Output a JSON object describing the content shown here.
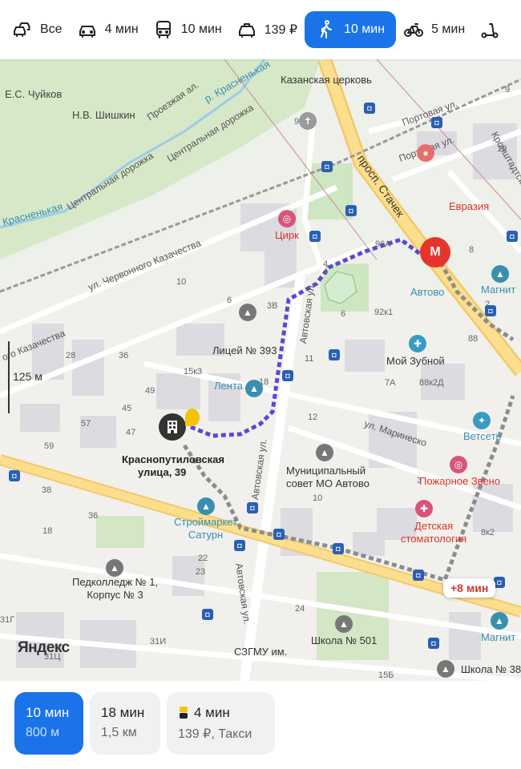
{
  "modes": [
    {
      "label": "Все",
      "icon": "cars-all-icon"
    },
    {
      "label": "4 мин",
      "icon": "car-icon"
    },
    {
      "label": "10 мин",
      "icon": "bus-icon"
    },
    {
      "label": "139 ₽",
      "icon": "taxi-icon"
    },
    {
      "label": "10 мин",
      "icon": "walk-icon",
      "active": true
    },
    {
      "label": "5 мин",
      "icon": "bicycle-icon"
    },
    {
      "label": "",
      "icon": "scooter-icon"
    }
  ],
  "map": {
    "labels": {
      "chuikov": "Е.С. Чуйков",
      "shishkin": "Н.В. Шишкин",
      "proezzhaya": "Проезжая ал.",
      "krasnenkaya_top": "р. Красненькая",
      "krasnenkaya_left": "Красненькая",
      "central1": "Центральная дорожка",
      "central2": "Центральная дорожка",
      "kazan_church": "Казанская церковь",
      "portovaya1": "Портовая ул.",
      "portovaya2": "Портовая ул.",
      "kronshtadt": "Кронштадтская ул.",
      "stachek": "просп. Стачек",
      "evraziya": "Евразия",
      "circus": "Цирк",
      "chervonnogo": "ул. Червонного Казачества",
      "kazachestva": "ого Казачества",
      "avtovskaya_top": "Автовская ул.",
      "avtovskaya_mid": "Автовская ул.",
      "avtovskaya_bot": "Автовская ул.",
      "metro_station": "Автово",
      "metro_pin": "М",
      "magnit_top": "Магнит",
      "lyceum": "Лицей № 393",
      "lenta": "Лента",
      "moy_zubnoy": "Мой Зубной",
      "marinesko": "ул. Маринеско",
      "vetset": "Ветсеть",
      "dest_line1": "Краснопутиловская",
      "dest_line2": "улица, 39",
      "municipal1": "Муниципальный",
      "municipal2": "совет МО Автово",
      "pozharnoe": "Пожарное Звено",
      "stroymarket1": "Строймаркет",
      "stroymarket2": "Сатурн",
      "dental1": "Детская",
      "dental2": "стоматология",
      "pedcollege1": "Педколледж № 1,",
      "pedcollege2": "Корпус № 3",
      "school501": "Школа № 501",
      "school386": "Школа № 386",
      "szgmu": "СЗГМУ им.",
      "magnit_bot": "Магнит"
    },
    "numbers": [
      "98В",
      "19",
      "9",
      "6",
      "4",
      "96А",
      "10",
      "6",
      "3В",
      "92к1",
      "6",
      "15к3",
      "88к2Д",
      "7А",
      "12",
      "28",
      "36",
      "49",
      "45",
      "47",
      "59",
      "57",
      "38",
      "36",
      "18",
      "22",
      "23",
      "8к2",
      "24",
      "31Г",
      "31И",
      "31Ц",
      "15Б",
      "10",
      "11",
      "18",
      "8",
      "4",
      "2",
      "3",
      "88"
    ],
    "scale": "125 м",
    "extra_time": "+8 мин",
    "yandex": "Яндекс",
    "route_color": "#5b47d6",
    "accent": "#1a73e8"
  },
  "bottom": {
    "cards": [
      {
        "time": "10 мин",
        "sub": "800 м",
        "active": true
      },
      {
        "time": "18 мин",
        "sub": "1,5 км"
      },
      {
        "time": "4 мин",
        "sub": "139 ₽, Такси",
        "taxi": true
      }
    ]
  }
}
